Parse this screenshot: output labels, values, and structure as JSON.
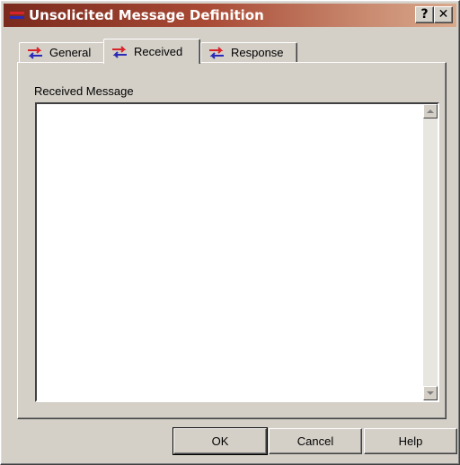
{
  "window": {
    "title": "Unsolicited Message Definition",
    "title_icon": "message-arrows-icon",
    "help_button_label": "?",
    "close_button_label": "✕"
  },
  "tabs": [
    {
      "label": "General",
      "icon": "exchange-arrows-icon",
      "selected": false
    },
    {
      "label": "Received",
      "icon": "exchange-arrows-icon",
      "selected": true
    },
    {
      "label": "Response",
      "icon": "exchange-arrows-icon",
      "selected": false
    }
  ],
  "received": {
    "label": "Received Message",
    "value": ""
  },
  "buttons": {
    "ok": "OK",
    "cancel": "Cancel",
    "help": "Help"
  },
  "colors": {
    "titlebar_start": "#7a2a1e",
    "titlebar_end": "#d9a98c",
    "face": "#d4d0c8",
    "icon_red": "#d8232a",
    "icon_blue": "#2a2ab8"
  }
}
